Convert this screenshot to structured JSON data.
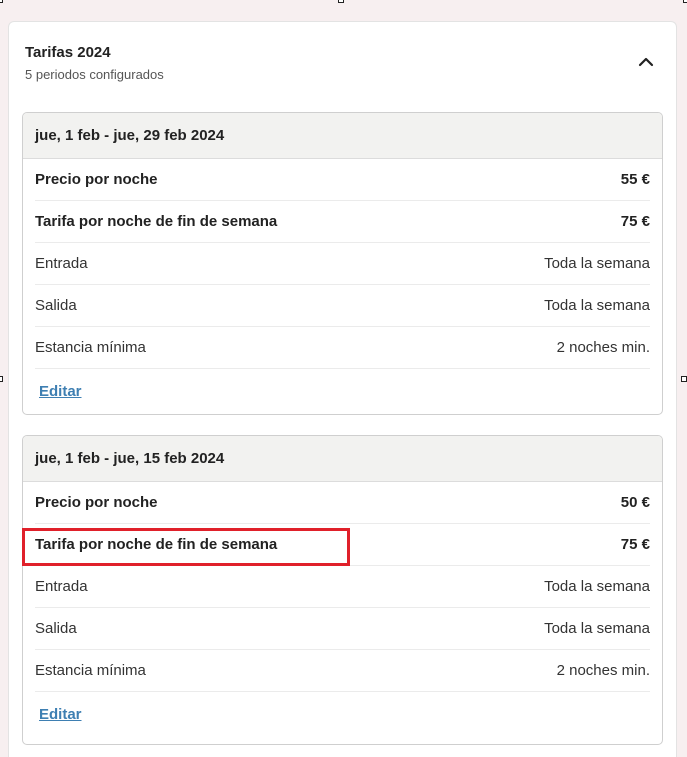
{
  "card": {
    "title": "Tarifas 2024",
    "subtitle": "5 periodos configurados"
  },
  "periods": [
    {
      "range": "jue, 1 feb - jue, 29 feb 2024",
      "rows": [
        {
          "label": "Precio por noche",
          "value": "55 €"
        },
        {
          "label": "Tarifa por noche de fin de semana",
          "value": "75 €"
        },
        {
          "label": "Entrada",
          "value": "Toda la semana"
        },
        {
          "label": "Salida",
          "value": "Toda la semana"
        },
        {
          "label": "Estancia mínima",
          "value": "2 noches min."
        }
      ],
      "edit_label": "Editar"
    },
    {
      "range": "jue, 1 feb - jue, 15 feb 2024",
      "rows": [
        {
          "label": "Precio por noche",
          "value": "50 €"
        },
        {
          "label": "Tarifa por noche de fin de semana",
          "value": "75 €"
        },
        {
          "label": "Entrada",
          "value": "Toda la semana"
        },
        {
          "label": "Salida",
          "value": "Toda la semana"
        },
        {
          "label": "Estancia mínima",
          "value": "2 noches min."
        }
      ],
      "edit_label": "Editar"
    }
  ],
  "icons": {
    "collapse": "chevron-up-icon"
  },
  "colors": {
    "link": "#3e7fb2",
    "highlight": "#e0202a",
    "header_bg": "#f2f2f0"
  }
}
